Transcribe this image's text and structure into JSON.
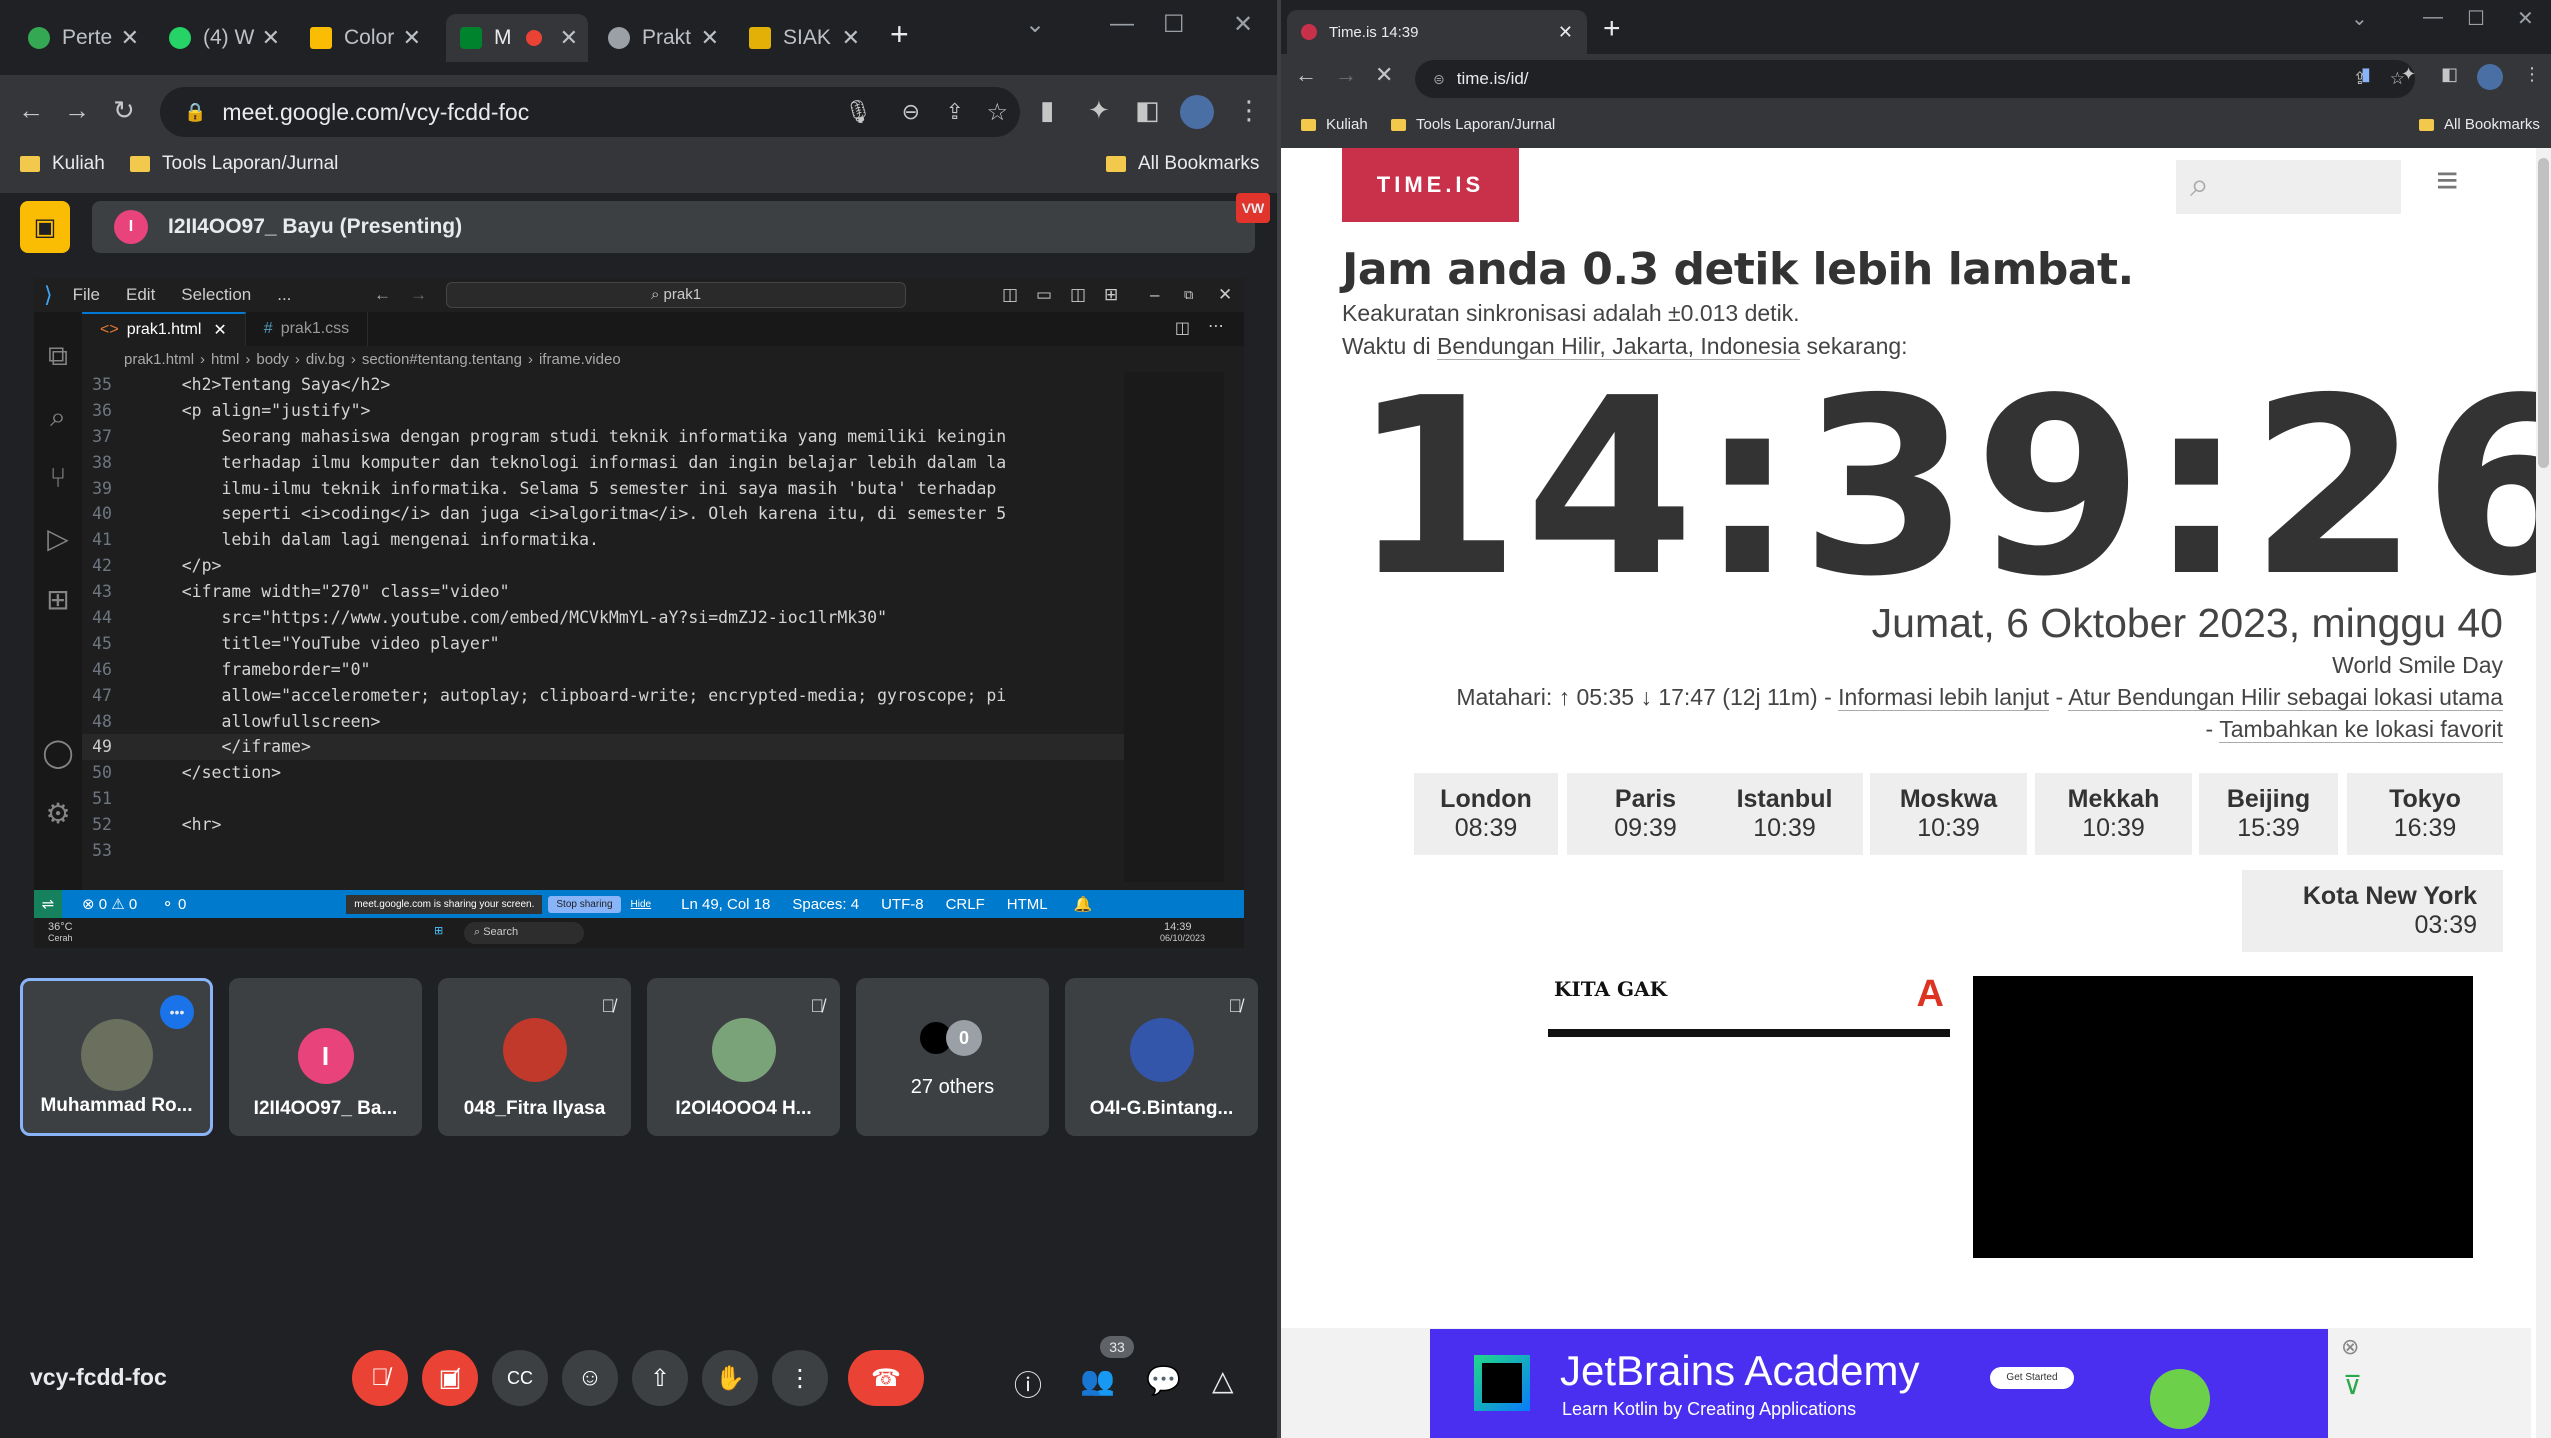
{
  "left_browser": {
    "tabs": [
      {
        "label": "Perte",
        "color": "#34a853"
      },
      {
        "label": "(4) W",
        "color": "#25d366"
      },
      {
        "label": "Color",
        "color": "#fbbc04"
      },
      {
        "label": "M",
        "color": "#00832d"
      },
      {
        "label": "Prakt",
        "color": "#9aa0a6"
      },
      {
        "label": "SIAK",
        "color": "#e2b007"
      }
    ],
    "url": "meet.google.com/vcy-fcdd-foc",
    "bookmarks": [
      "Kuliah",
      "Tools Laporan/Jurnal"
    ],
    "all_bookmarks": "All Bookmarks"
  },
  "meet": {
    "presenting": "I2II4OO97_ Bayu (Presenting)",
    "presenter_initial": "I",
    "meeting_code": "vcy-fcdd-foc",
    "people_count": "33",
    "participants": [
      {
        "name": "Muhammad Ro...",
        "muted": false
      },
      {
        "name": "I2II4OO97_ Ba...",
        "initial": "I",
        "muted": false
      },
      {
        "name": "048_Fitra Ilyasa",
        "muted": true
      },
      {
        "name": "I2OI4OOO4 H...",
        "muted": true
      },
      {
        "name": "27 others",
        "extra": "0",
        "muted": false
      },
      {
        "name": "O4I-G.Bintang...",
        "muted": true
      }
    ]
  },
  "vscode": {
    "menu": [
      "File",
      "Edit",
      "Selection",
      "..."
    ],
    "search": "prak1",
    "tabs": [
      "prak1.html",
      "prak1.css"
    ],
    "breadcrumb": [
      "prak1.html",
      "html",
      "body",
      "div.bg",
      "section#tentang.tentang",
      "iframe.video"
    ],
    "lines": [
      {
        "n": "35",
        "t": "    <h2>Tentang Saya</h2>"
      },
      {
        "n": "36",
        "t": "    <p align=\"justify\">"
      },
      {
        "n": "37",
        "t": "        Seorang mahasiswa dengan program studi teknik informatika yang memiliki keingin"
      },
      {
        "n": "38",
        "t": "        terhadap ilmu komputer dan teknologi informasi dan ingin belajar lebih dalam la"
      },
      {
        "n": "39",
        "t": "        ilmu-ilmu teknik informatika. Selama 5 semester ini saya masih 'buta' terhadap"
      },
      {
        "n": "40",
        "t": "        seperti <i>coding</i> dan juga <i>algoritma</i>. Oleh karena itu, di semester 5"
      },
      {
        "n": "41",
        "t": "        lebih dalam lagi mengenai informatika."
      },
      {
        "n": "42",
        "t": "    </p>"
      },
      {
        "n": "43",
        "t": "    <iframe width=\"270\" class=\"video\""
      },
      {
        "n": "44",
        "t": "        src=\"https://www.youtube.com/embed/MCVkMmYL-aY?si=dmZJ2-ioc1lrMk30\""
      },
      {
        "n": "45",
        "t": "        title=\"YouTube video player\""
      },
      {
        "n": "46",
        "t": "        frameborder=\"0\""
      },
      {
        "n": "47",
        "t": "        allow=\"accelerometer; autoplay; clipboard-write; encrypted-media; gyroscope; pi"
      },
      {
        "n": "48",
        "t": "        allowfullscreen>"
      },
      {
        "n": "49",
        "t": "        </iframe>"
      },
      {
        "n": "50",
        "t": "    </section>"
      },
      {
        "n": "51",
        "t": ""
      },
      {
        "n": "52",
        "t": "    <hr>"
      },
      {
        "n": "53",
        "t": ""
      }
    ],
    "status": {
      "errors": "⊗ 0 ⚠ 0",
      "ports": "0",
      "sharing": "meet.google.com is sharing your screen.",
      "stop": "Stop sharing",
      "hide": "Hide",
      "pos": "Ln 49, Col 18",
      "spaces": "Spaces: 4",
      "enc": "UTF-8",
      "eol": "CRLF",
      "lang": "HTML"
    },
    "taskbar": {
      "weather": "36°C",
      "weather_sub": "Cerah",
      "search": "Search",
      "time": "14:39",
      "date": "06/10/2023"
    }
  },
  "right_browser": {
    "tab_title": "Time.is 14:39",
    "url": "time.is/id/",
    "bookmarks": [
      "Kuliah",
      "Tools Laporan/Jurnal"
    ],
    "all_bookmarks": "All Bookmarks"
  },
  "timeis": {
    "logo": "TIME.IS",
    "headline": "Jam anda 0.3 detik lebih lambat.",
    "accuracy": "Keakuratan sinkronisasi adalah ±0.013 detik.",
    "location_prefix": "Waktu di ",
    "location": "Bendungan Hilir, Jakarta, Indonesia",
    "location_suffix": " sekarang:",
    "clock": "14:39:26",
    "date": "Jumat, 6 Oktober 2023, minggu 40",
    "holiday": "World Smile Day",
    "sun": "Matahari: ↑ 05:35 ↓ 17:47 (12j 11m) - ",
    "more_info": "Informasi lebih lanjut",
    "set_location": "Atur Bendungan Hilir sebagai lokasi utama",
    "add_fav": "Tambahkan ke lokasi favorit",
    "cities": [
      {
        "name": "London",
        "time": "08:39"
      },
      {
        "name": "Paris",
        "time": "09:39"
      },
      {
        "name": "Istanbul",
        "time": "10:39"
      },
      {
        "name": "Moskwa",
        "time": "10:39"
      },
      {
        "name": "Mekkah",
        "time": "10:39"
      },
      {
        "name": "Beijing",
        "time": "15:39"
      },
      {
        "name": "Tokyo",
        "time": "16:39"
      }
    ],
    "city_big": {
      "name": "Kota New York",
      "time": "03:39"
    },
    "video_caption": "KITA GAK",
    "ad_title": "JetBrains Academy",
    "ad_sub": "Learn Kotlin by Creating Applications",
    "ad_btn": "Get Started"
  },
  "colors": {
    "meet_red": "#ea4335",
    "timeis_red": "#c9304a",
    "vscode_blue": "#007acc",
    "participant_border": "#8ab4f8"
  }
}
